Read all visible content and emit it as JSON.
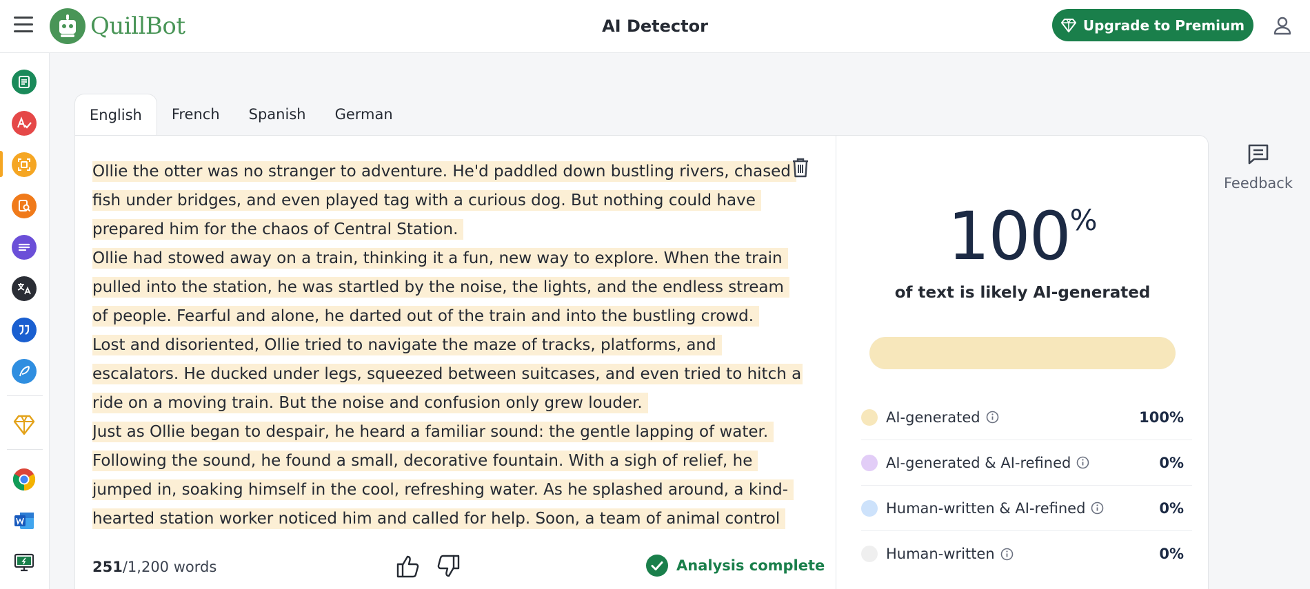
{
  "header": {
    "brand": "QuillBot",
    "title": "AI Detector",
    "upgrade_label": "Upgrade to Premium"
  },
  "sidebar": {
    "items": [
      {
        "name": "paraphraser",
        "color": "#1a8a5a"
      },
      {
        "name": "grammar-checker",
        "color": "#e54848"
      },
      {
        "name": "ai-detector",
        "color": "#f5a623"
      },
      {
        "name": "plagiarism-checker",
        "color": "#f07a1a"
      },
      {
        "name": "summarizer",
        "color": "#6b4fd8"
      },
      {
        "name": "translator",
        "color": "#2a2d35"
      },
      {
        "name": "citation-generator",
        "color": "#1a5fd0"
      },
      {
        "name": "ai-writer",
        "color": "#2f8ee0"
      },
      {
        "name": "premium",
        "color": "#e3a21a"
      },
      {
        "name": "chrome-extension",
        "color": "#4285f4"
      },
      {
        "name": "word-addin",
        "color": "#2b5fb8"
      },
      {
        "name": "desktop-app",
        "color": "#1a7f4b"
      }
    ]
  },
  "tabs": [
    {
      "label": "English",
      "active": true
    },
    {
      "label": "French",
      "active": false
    },
    {
      "label": "Spanish",
      "active": false
    },
    {
      "label": "German",
      "active": false
    }
  ],
  "editor": {
    "paragraphs": [
      "Ollie the otter was no stranger to adventure. He'd paddled down bustling rivers, chased fish under bridges, and even played tag with a curious dog. But nothing could have prepared him for the chaos of Central Station.",
      "Ollie had stowed away on a train, thinking it a fun, new way to explore. When the train pulled into the station, he was startled by the noise, the lights, and the endless stream of people. Fearful and alone, he darted out of the train and into the bustling crowd.",
      "Lost and disoriented, Ollie tried to navigate the maze of tracks, platforms, and escalators. He ducked under legs, squeezed between suitcases, and even tried to hitch a ride on a moving train. But the noise and confusion only grew louder.",
      "Just as Ollie began to despair, he heard a familiar sound: the gentle lapping of water. Following the sound, he found a small, decorative fountain. With a sigh of relief, he jumped in, soaking himself in the cool, refreshing water. As he splashed around, a kind-hearted station worker noticed him and called for help. Soon, a team of animal control"
    ],
    "word_count": "251",
    "word_limit": "/1,200 words",
    "status": "Analysis complete"
  },
  "results": {
    "score": "100",
    "score_unit": "%",
    "caption": "of text is likely AI-generated",
    "bar_fill_percent": 100,
    "legend": [
      {
        "label": "AI-generated",
        "value": "100%",
        "color": "#f7e7bb"
      },
      {
        "label": "AI-generated & AI-refined",
        "value": "0%",
        "color": "#e2cdf7"
      },
      {
        "label": "Human-written & AI-refined",
        "value": "0%",
        "color": "#cde2fb"
      },
      {
        "label": "Human-written",
        "value": "0%",
        "color": "#efefef"
      }
    ]
  },
  "feedback": {
    "label": "Feedback"
  },
  "colors": {
    "brand_green": "#499557",
    "premium_green": "#1a7f4b",
    "highlight": "#fcefd5"
  }
}
